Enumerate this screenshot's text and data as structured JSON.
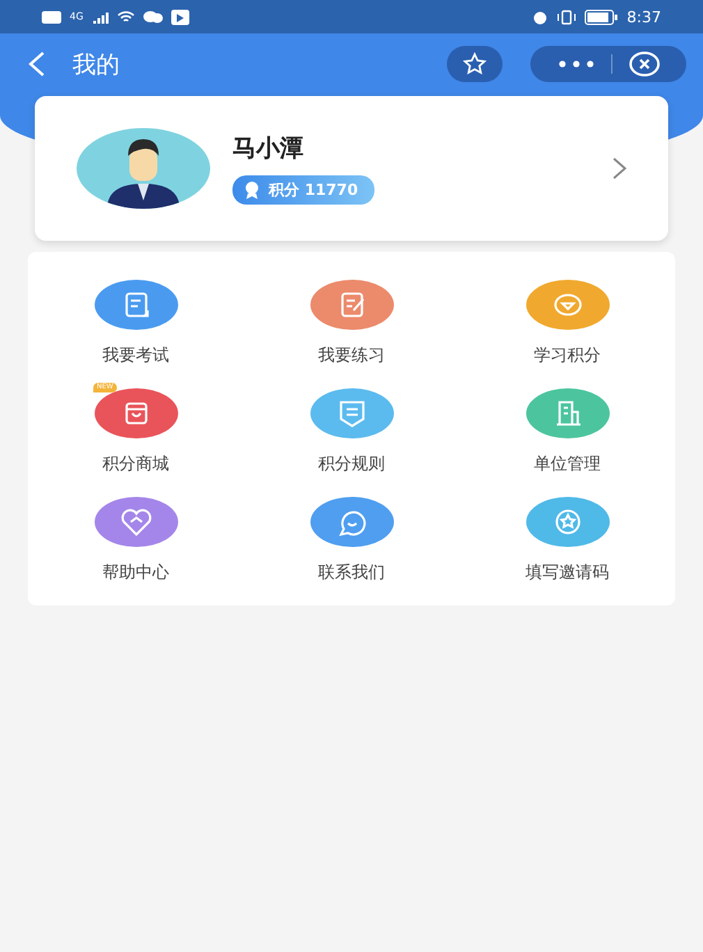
{
  "status_bar": {
    "network": "4G",
    "time": "8:37"
  },
  "header": {
    "title": "我的"
  },
  "profile": {
    "name": "马小潭",
    "points_label": "积分 11770"
  },
  "menu": [
    {
      "label": "我要考试",
      "kind": "exam",
      "color": "#4a9bf0"
    },
    {
      "label": "我要练习",
      "kind": "practice",
      "color": "#ec8a6c"
    },
    {
      "label": "学习积分",
      "kind": "points",
      "color": "#f0a92e"
    },
    {
      "label": "积分商城",
      "kind": "shop",
      "color": "#e9545a",
      "badge": "NEW"
    },
    {
      "label": "积分规则",
      "kind": "rules",
      "color": "#5bbbee"
    },
    {
      "label": "单位管理",
      "kind": "org",
      "color": "#4cc59e"
    },
    {
      "label": "帮助中心",
      "kind": "help",
      "color": "#a486ea"
    },
    {
      "label": "联系我们",
      "kind": "contact",
      "color": "#4f9ef0"
    },
    {
      "label": "填写邀请码",
      "kind": "invite",
      "color": "#4fb9e8"
    }
  ]
}
